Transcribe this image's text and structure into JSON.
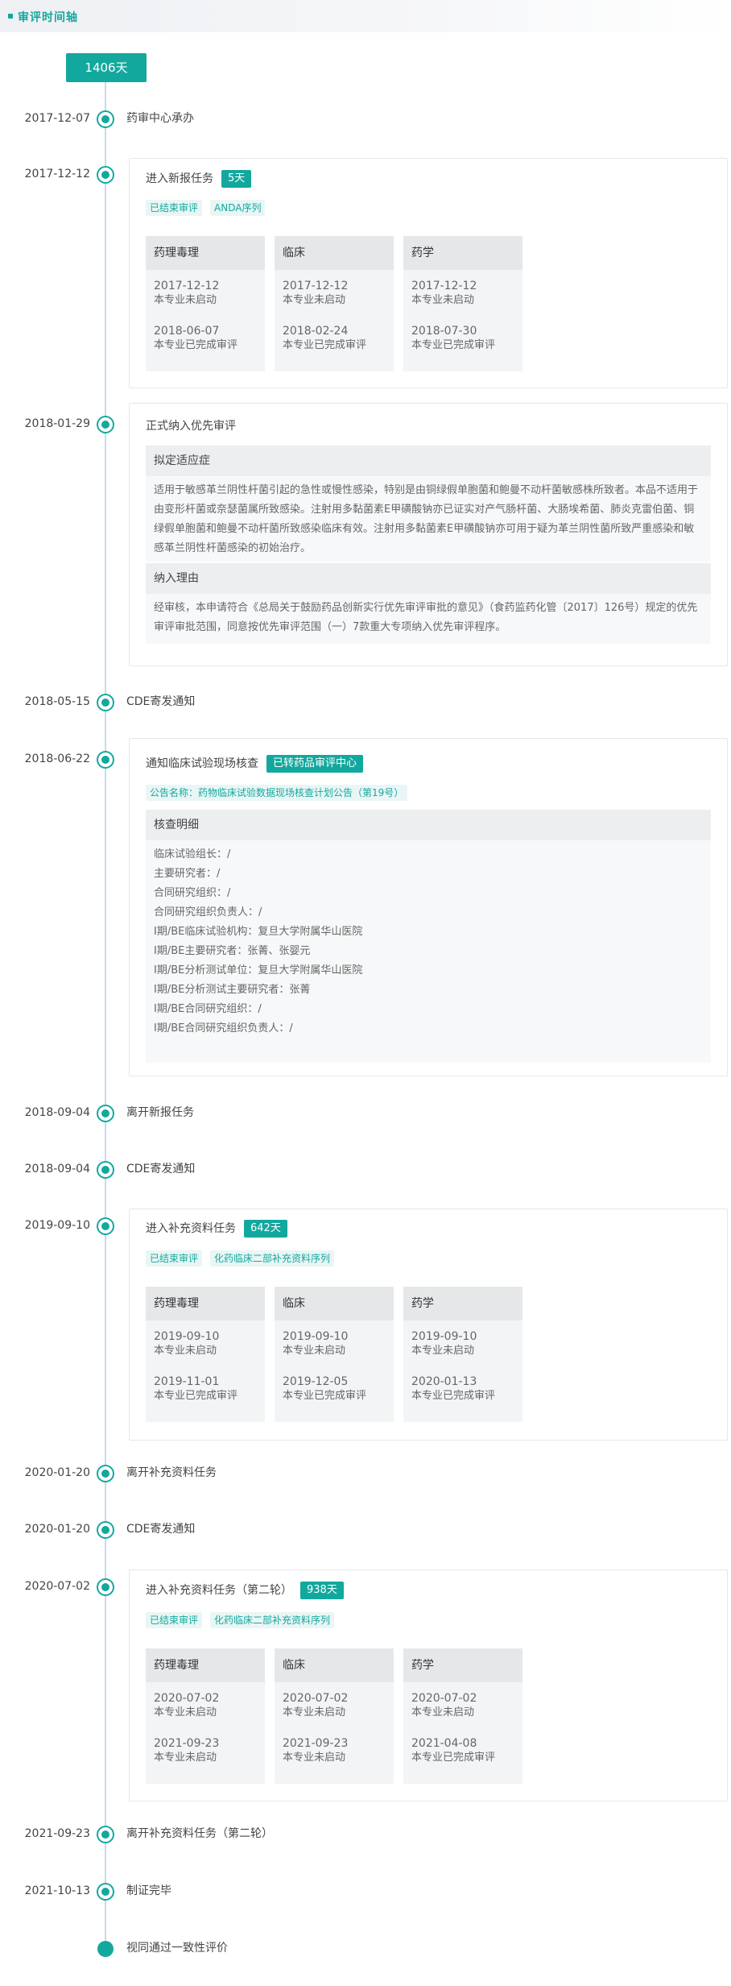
{
  "header": {
    "title": "审评时间轴"
  },
  "total_days": "1406天",
  "events": {
    "e1": {
      "date": "2017-12-07",
      "label": "药审中心承办"
    },
    "e2": {
      "date": "2017-12-12"
    },
    "e3": {
      "date": "2018-01-29"
    },
    "e4": {
      "date": "2018-05-15",
      "label": "CDE寄发通知"
    },
    "e5": {
      "date": "2018-06-22"
    },
    "e6": {
      "date": "2018-09-04",
      "label": "离开新报任务"
    },
    "e7": {
      "date": "2018-09-04",
      "label": "CDE寄发通知"
    },
    "e8": {
      "date": "2019-09-10"
    },
    "e9": {
      "date": "2020-01-20",
      "label": "离开补充资料任务"
    },
    "e10": {
      "date": "2020-01-20",
      "label": "CDE寄发通知"
    },
    "e11": {
      "date": "2020-07-02"
    },
    "e12": {
      "date": "2021-09-23",
      "label": "离开补充资料任务（第二轮）"
    },
    "e13": {
      "date": "2021-10-13",
      "label": "制证完毕"
    },
    "e14": {
      "label": "视同通过一致性评价"
    }
  },
  "card1": {
    "title": "进入新报任务",
    "badge": "5天",
    "tags": [
      "已结束审评",
      "ANDA序列"
    ],
    "cols": [
      {
        "head": "药理毒理",
        "d1": "2017-12-12",
        "s1": "本专业未启动",
        "d2": "2018-06-07",
        "s2": "本专业已完成审评"
      },
      {
        "head": "临床",
        "d1": "2017-12-12",
        "s1": "本专业未启动",
        "d2": "2018-02-24",
        "s2": "本专业已完成审评"
      },
      {
        "head": "药学",
        "d1": "2017-12-12",
        "s1": "本专业未启动",
        "d2": "2018-07-30",
        "s2": "本专业已完成审评"
      }
    ]
  },
  "card2": {
    "title": "正式纳入优先审评",
    "sec1_title": "拟定适应症",
    "sec1_text": "适用于敏感革兰阴性杆菌引起的急性或慢性感染，特别是由铜绿假单胞菌和鲍曼不动杆菌敏感株所致者。本品不适用于由变形杆菌或奈瑟菌属所致感染。注射用多黏菌素E甲磺酸钠亦已证实对产气肠杆菌、大肠埃希菌、肺炎克雷伯菌、铜绿假单胞菌和鲍曼不动杆菌所致感染临床有效。注射用多黏菌素E甲磺酸钠亦可用于疑为革兰阴性菌所致严重感染和敏感革兰阴性杆菌感染的初始治疗。",
    "sec2_title": "纳入理由",
    "sec2_text": "经审核，本申请符合《总局关于鼓励药品创新实行优先审评审批的意见》（食药监药化管〔2017〕126号）规定的优先审评审批范围，同意按优先审评范围（一）7款重大专项纳入优先审评程序。"
  },
  "card3": {
    "title": "通知临床试验现场核查",
    "badge": "已转药品审评中心",
    "notice": "公告名称：药物临床试验数据现场核查计划公告（第19号）",
    "sec_title": "核查明细",
    "items": [
      "临床试验组长：/",
      "主要研究者：/",
      "合同研究组织：/",
      "合同研究组织负责人：/",
      "I期/BE临床试验机构：复旦大学附属华山医院",
      "I期/BE主要研究者：张菁、张婴元",
      "I期/BE分析测试单位：复旦大学附属华山医院",
      "I期/BE分析测试主要研究者：张菁",
      "I期/BE合同研究组织：/",
      "I期/BE合同研究组织负责人：/"
    ]
  },
  "card4": {
    "title": "进入补充资料任务",
    "badge": "642天",
    "tags": [
      "已结束审评",
      "化药临床二部补充资料序列"
    ],
    "cols": [
      {
        "head": "药理毒理",
        "d1": "2019-09-10",
        "s1": "本专业未启动",
        "d2": "2019-11-01",
        "s2": "本专业已完成审评"
      },
      {
        "head": "临床",
        "d1": "2019-09-10",
        "s1": "本专业未启动",
        "d2": "2019-12-05",
        "s2": "本专业已完成审评"
      },
      {
        "head": "药学",
        "d1": "2019-09-10",
        "s1": "本专业未启动",
        "d2": "2020-01-13",
        "s2": "本专业已完成审评"
      }
    ]
  },
  "card5": {
    "title": "进入补充资料任务（第二轮）",
    "badge": "938天",
    "tags": [
      "已结束审评",
      "化药临床二部补充资料序列"
    ],
    "cols": [
      {
        "head": "药理毒理",
        "d1": "2020-07-02",
        "s1": "本专业未启动",
        "d2": "2021-09-23",
        "s2": "本专业未启动"
      },
      {
        "head": "临床",
        "d1": "2020-07-02",
        "s1": "本专业未启动",
        "d2": "2021-09-23",
        "s2": "本专业未启动"
      },
      {
        "head": "药学",
        "d1": "2020-07-02",
        "s1": "本专业未启动",
        "d2": "2021-04-08",
        "s2": "本专业已完成审评"
      }
    ]
  }
}
